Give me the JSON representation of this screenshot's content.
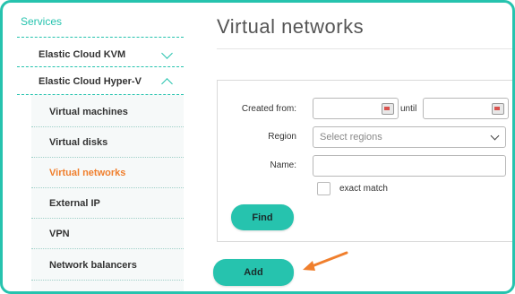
{
  "sidebar": {
    "section_title": "Services",
    "groups": [
      {
        "label": "Elastic Cloud KVM"
      },
      {
        "label": "Elastic Cloud Hyper-V"
      }
    ],
    "items": [
      {
        "label": "Virtual machines"
      },
      {
        "label": "Virtual disks"
      },
      {
        "label": "Virtual networks",
        "active": true
      },
      {
        "label": "External IP"
      },
      {
        "label": "VPN"
      },
      {
        "label": "Network balancers"
      }
    ]
  },
  "main": {
    "title": "Virtual networks",
    "filters": {
      "created_from_label": "Created from:",
      "until_label": "until",
      "region_label": "Region",
      "region_placeholder": "Select regions",
      "name_label": "Name:",
      "exact_match_label": "exact match",
      "find_label": "Find"
    },
    "add_label": "Add"
  },
  "colors": {
    "accent": "#26c3ae",
    "active_item": "#f07f2d",
    "arrow": "#f07f2d"
  }
}
